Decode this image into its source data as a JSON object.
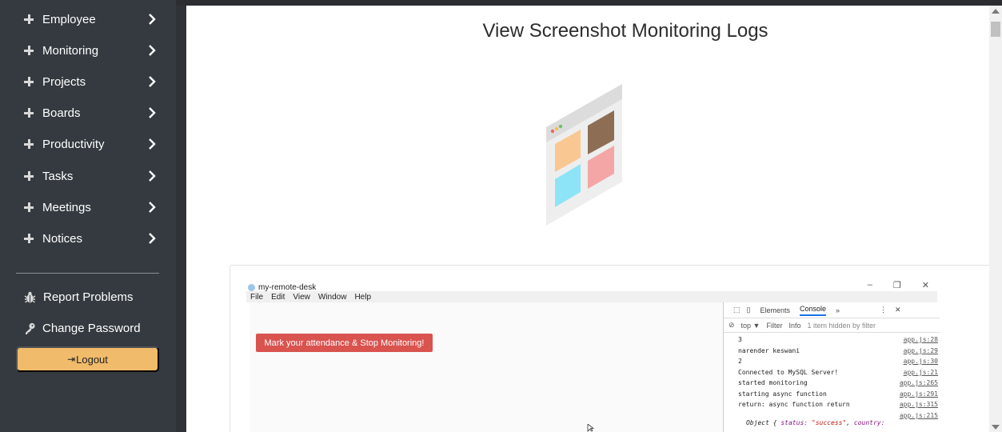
{
  "sidebar": {
    "items": [
      {
        "label": "Employee"
      },
      {
        "label": "Monitoring"
      },
      {
        "label": "Projects"
      },
      {
        "label": "Boards"
      },
      {
        "label": "Productivity"
      },
      {
        "label": "Tasks"
      },
      {
        "label": "Meetings"
      },
      {
        "label": "Notices"
      }
    ],
    "report_label": "Report Problems",
    "password_label": "Change Password",
    "logout_label": "Logout"
  },
  "main": {
    "title": "View Screenshot Monitoring Logs"
  },
  "screenshot": {
    "app_title": "my-remote-desk",
    "menu": [
      "File",
      "Edit",
      "View",
      "Window",
      "Help"
    ],
    "attendance_button": "Mark your attendance & Stop Monitoring!",
    "devtools": {
      "tabs": [
        "Elements",
        "Console"
      ],
      "more": "»",
      "context": "top ▼",
      "filter_placeholder": "Filter",
      "level": "Info",
      "hidden_note": "1 item hidden by filter",
      "logs": [
        {
          "text": "3",
          "src": "app.js:28"
        },
        {
          "text": "narender keswani",
          "src": "app.js:29"
        },
        {
          "text": "2",
          "src": "app.js:30"
        },
        {
          "text": "Connected to MySQL Server!",
          "src": "app.js:21"
        },
        {
          "text": "started monitoring",
          "src": "app.js:265"
        },
        {
          "text": "starting async function",
          "src": "app.js:291"
        },
        {
          "text": "return:  async function return",
          "src": "app.js:315"
        },
        {
          "text": "",
          "src": "app.js:215"
        }
      ],
      "object_line_prefix": "Object {",
      "object_key1": "status:",
      "object_val1": "\"success\"",
      "object_key2": "country:"
    }
  },
  "colors": {
    "sidebar_bg": "#343a40",
    "logout_bg": "#f0bb6a",
    "attendance_btn": "#d9534f"
  }
}
